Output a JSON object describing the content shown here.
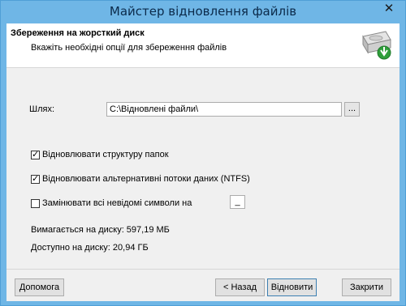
{
  "window": {
    "title": "Майстер відновлення файлів",
    "close_glyph": "✕"
  },
  "header": {
    "title": "Збереження на жорсткий диск",
    "subtitle": "Вкажіть необхідні опції для збереження файлів",
    "icon": "hard-disk-save-icon"
  },
  "path": {
    "label": "Шлях:",
    "value": "C:\\Відновлені файли\\",
    "browse_label": "..."
  },
  "options": {
    "preserve_structure": {
      "label": "Відновлювати структуру папок",
      "checked": true
    },
    "alt_streams": {
      "label": "Відновлювати альтернативні потоки даних (NTFS)",
      "checked": true
    },
    "replace_symbols": {
      "label": "Замінювати всі невідомі символи на",
      "checked": false,
      "symbol": "_"
    }
  },
  "disk": {
    "required_label": "Вимагається на диску: 597,19 МБ",
    "available_label": "Доступно на диску: 20,94 ГБ"
  },
  "footer": {
    "help": "Допомога",
    "back": "< Назад",
    "restore": "Відновити",
    "close": "Закрити"
  },
  "colors": {
    "titlebar": "#6fb6e6",
    "client_bg": "#f0f0f0",
    "header_bg": "#ffffff",
    "accent_icon": "#2e9e3a"
  }
}
